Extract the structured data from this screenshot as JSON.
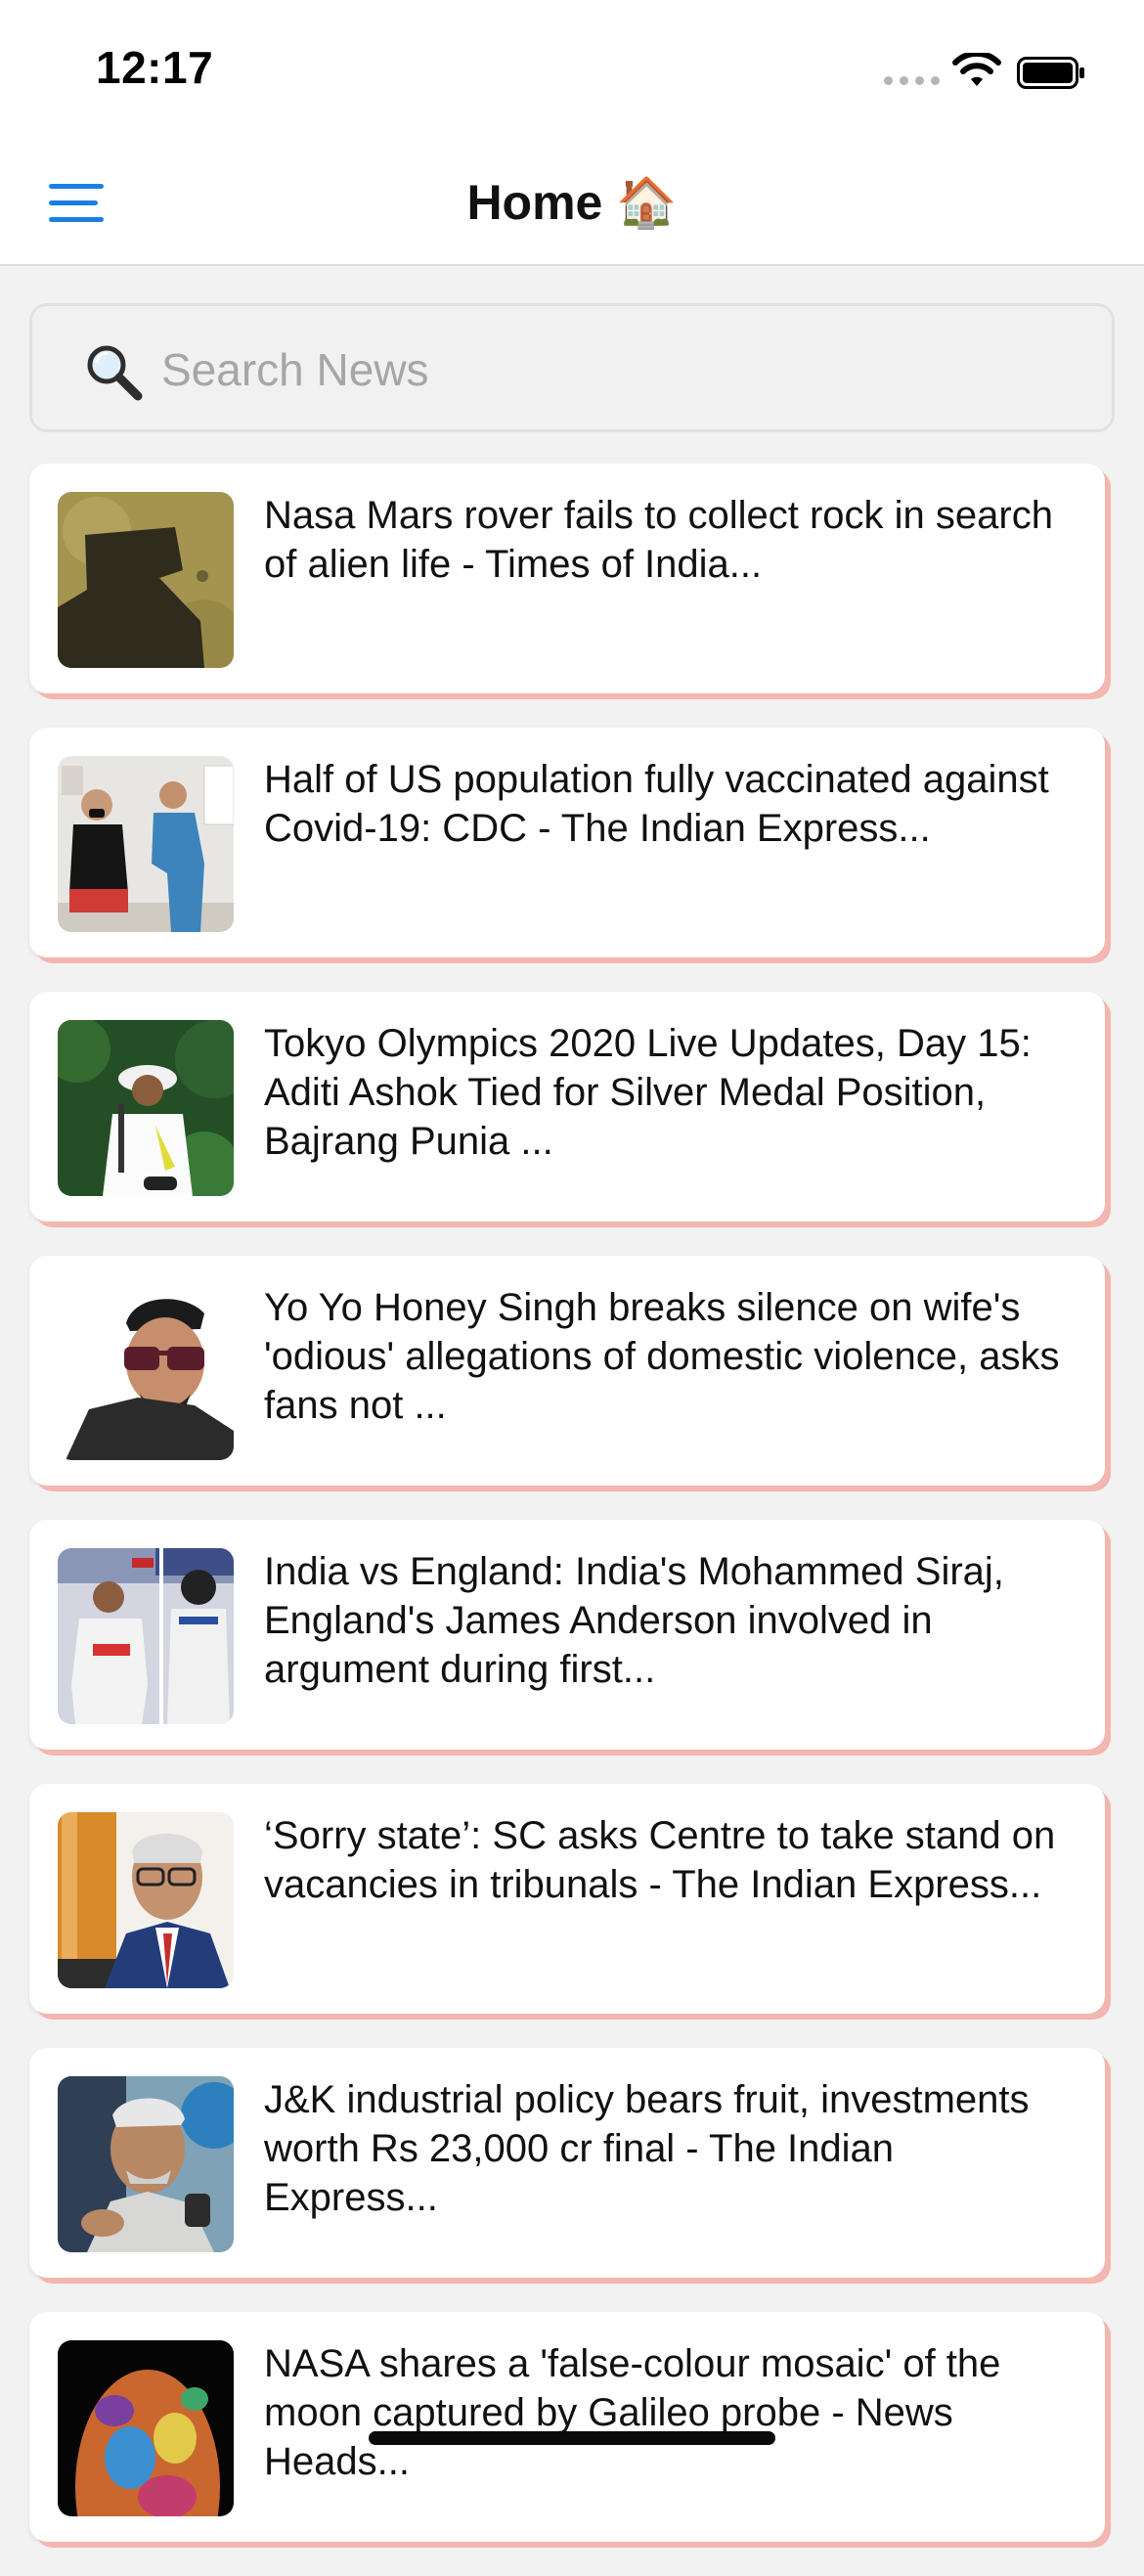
{
  "status_bar": {
    "time": "12:17"
  },
  "header": {
    "title": "Home 🏠"
  },
  "search": {
    "placeholder": "Search News",
    "value": ""
  },
  "news": [
    {
      "title": "Nasa Mars rover fails to collect rock in search of alien life - Times of India..."
    },
    {
      "title": "Half of US population fully vaccinated against Covid-19: CDC - The Indian Express..."
    },
    {
      "title": "Tokyo Olympics 2020 Live Updates, Day 15: Aditi Ashok Tied for Silver Medal Position, Bajrang Punia ..."
    },
    {
      "title": "Yo Yo Honey Singh breaks silence on wife's 'odious' allegations of domestic violence, asks fans not ..."
    },
    {
      "title": "India vs England: India's Mohammed Siraj, England's James Anderson involved in argument during first..."
    },
    {
      "title": "‘Sorry state’: SC asks Centre to take stand on vacancies in tribunals - The Indian Express..."
    },
    {
      "title": "J&K industrial policy bears fruit, investments worth Rs 23,000 cr final - The Indian Express..."
    },
    {
      "title": "NASA shares a 'false-colour mosaic' of the moon captured by Galileo probe - News Heads..."
    }
  ],
  "icons": {
    "menu": "menu-icon",
    "search": "magnifier-icon"
  },
  "colors": {
    "accent": "#1a7fe5",
    "card_shadow": "#f4b6b0",
    "background": "#f2f2f2"
  }
}
